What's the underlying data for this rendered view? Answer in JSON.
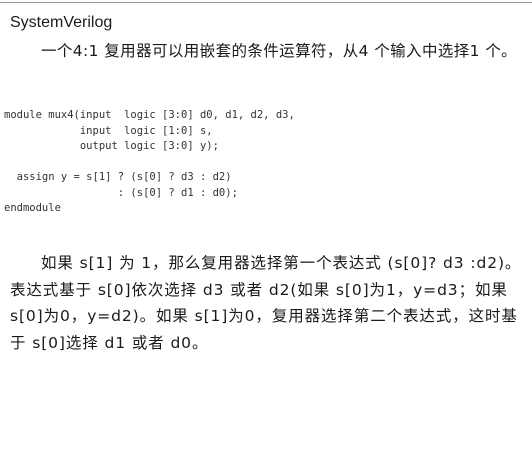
{
  "section": {
    "language_label": "SystemVerilog"
  },
  "intro_paragraph": "一个4:1 复用器可以用嵌套的条件运算符，从4 个输入中选择1 个。",
  "code_lines": [
    "module mux4(input  logic [3:0] d0, d1, d2, d3,",
    "            input  logic [1:0] s,",
    "            output logic [3:0] y);",
    "",
    "  assign y = s[1] ? (s[0] ? d3 : d2)",
    "                  : (s[0] ? d1 : d0);",
    "endmodule"
  ],
  "explanation_paragraph": "如果 s[1] 为 1，那么复用器选择第一个表达式 (s[0]? d3 :d2)。表达式基于 s[0]依次选择 d3 或者 d2(如果 s[0]为1，y=d3；如果 s[0]为0，y=d2)。如果 s[1]为0，复用器选择第二个表达式，这时基于 s[0]选择 d1 或者 d0。"
}
